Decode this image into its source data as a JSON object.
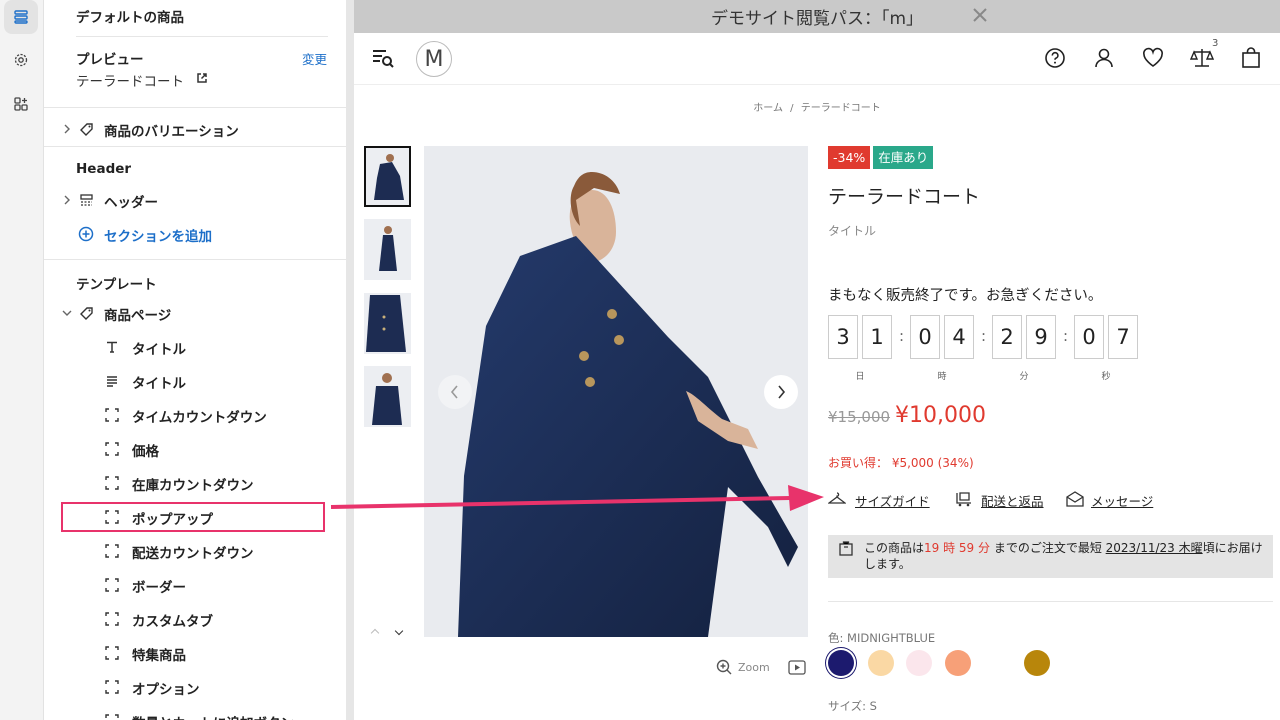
{
  "panel": {
    "default_product": "デフォルトの商品",
    "preview_label": "プレビュー",
    "change_link": "変更",
    "preview_product": "テーラードコート",
    "variations": "商品のバリエーション",
    "header_section": "Header",
    "header_item": "ヘッダー",
    "add_section": "セクションを追加",
    "template_section": "テンプレート",
    "product_page": "商品ページ",
    "blocks": [
      {
        "label": "タイトル",
        "icon": "text-icon"
      },
      {
        "label": "タイトル",
        "icon": "lines-icon"
      },
      {
        "label": "タイムカウントダウン",
        "icon": "block-icon"
      },
      {
        "label": "価格",
        "icon": "block-icon"
      },
      {
        "label": "在庫カウントダウン",
        "icon": "block-icon"
      },
      {
        "label": "ポップアップ",
        "icon": "block-icon"
      },
      {
        "label": "配送カウントダウン",
        "icon": "block-icon"
      },
      {
        "label": "ボーダー",
        "icon": "block-icon"
      },
      {
        "label": "カスタムタブ",
        "icon": "block-icon"
      },
      {
        "label": "特集商品",
        "icon": "block-icon"
      },
      {
        "label": "オプション",
        "icon": "block-icon"
      },
      {
        "label": "数量とカートに追加ボタン",
        "icon": "block-icon"
      }
    ]
  },
  "banner": {
    "text": "デモサイト閲覧パス：「m」"
  },
  "store": {
    "logo": "M",
    "compare_count": "3"
  },
  "breadcrumb": {
    "home": "ホーム",
    "sep": "/",
    "current": "テーラードコート"
  },
  "product": {
    "discount_badge": "-34%",
    "stock_badge": "在庫あり",
    "title": "テーラードコート",
    "subtitle": "タイトル",
    "urgency": "まもなく販売終了です。お急ぎください。",
    "countdown": {
      "digits": [
        "3",
        "1",
        "0",
        "4",
        "2",
        "9",
        "0",
        "7"
      ],
      "units": [
        "日",
        "時",
        "分",
        "秒"
      ]
    },
    "old_price": "¥15,000",
    "price": "¥10,000",
    "savings": "お買い得： ¥5,000 (34%)",
    "actions": {
      "size_guide": "サイズガイド",
      "shipping": "配送と返品",
      "message": "メッセージ"
    },
    "delivery": {
      "pre": "この商品は",
      "time": "19 時 59 分",
      "mid": " までのご注文で最短 ",
      "date": "2023/11/23 木曜",
      "post": "頃にお届けします。"
    },
    "color_label": "色: MIDNIGHTBLUE",
    "size_label": "サイズ: S",
    "zoom_label": "Zoom",
    "swatches": [
      "#1c1a6e",
      "#fad8a4",
      "#fbe6ec",
      "#f7a078",
      "#ffffff",
      "#b8860b"
    ]
  },
  "colors": {
    "sale_red": "#e03a2f",
    "stock_teal": "#2aa88a",
    "link_blue": "#1d6fc9",
    "annotation_pink": "#e8336b"
  }
}
